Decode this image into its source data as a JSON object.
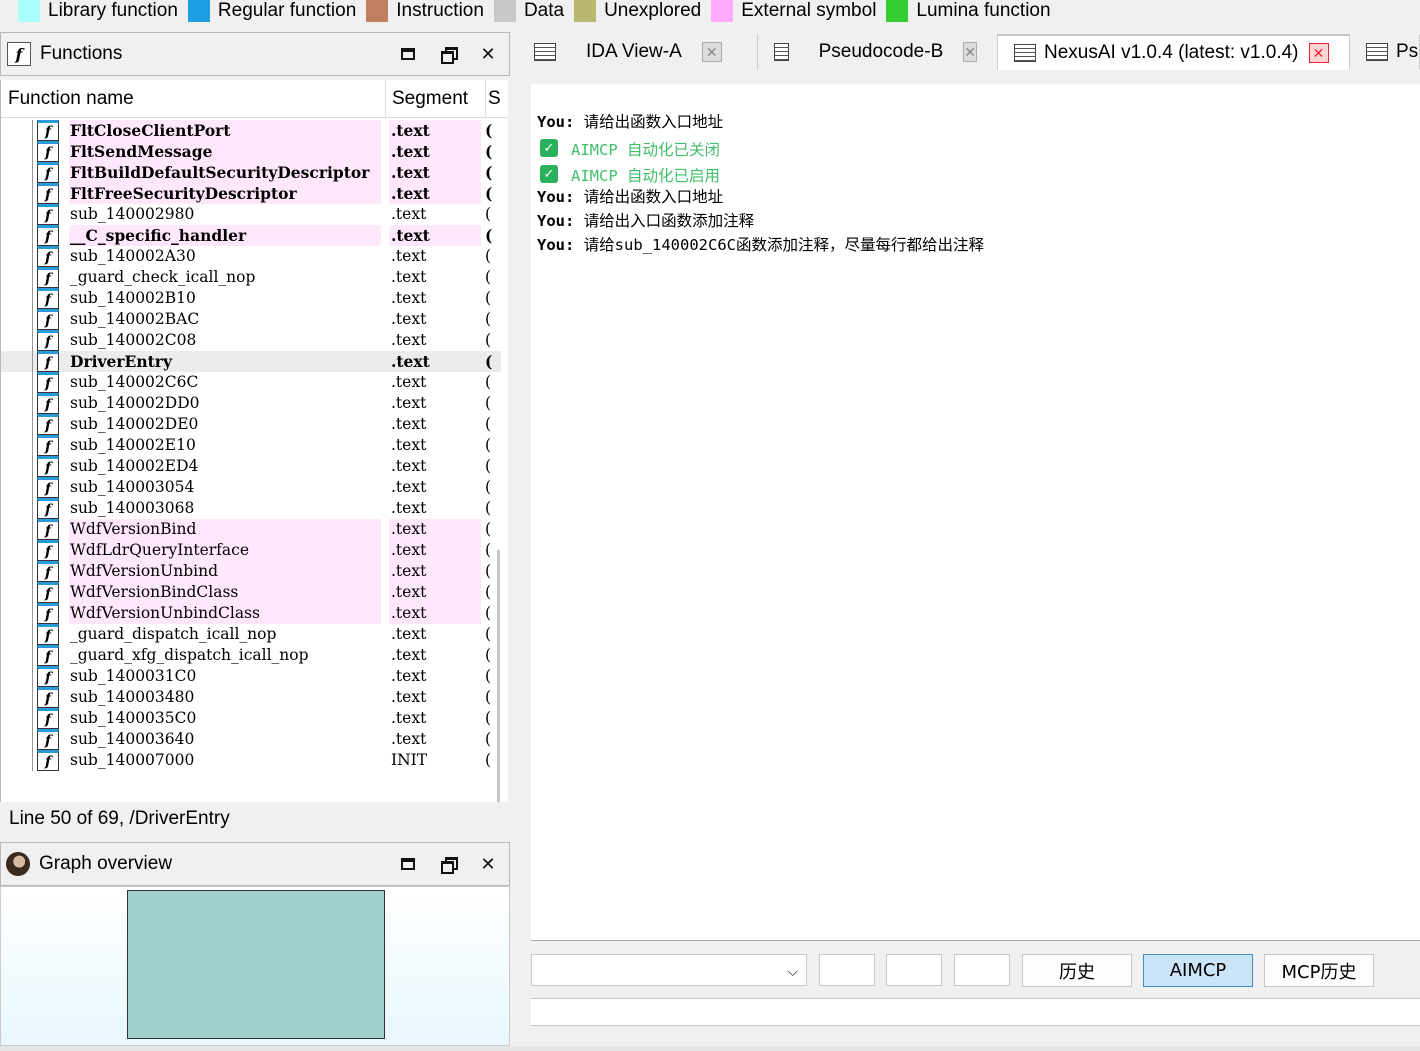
{
  "legend": [
    {
      "label": "Library function",
      "color": "#aaffff"
    },
    {
      "label": "Regular function",
      "color": "#1e9ee5"
    },
    {
      "label": "Instruction",
      "color": "#c08060"
    },
    {
      "label": "Data",
      "color": "#c8c8c8"
    },
    {
      "label": "Unexplored",
      "color": "#b8b870"
    },
    {
      "label": "External symbol",
      "color": "#ffaaff"
    },
    {
      "label": "Lumina function",
      "color": "#33cc33"
    }
  ],
  "functions_panel": {
    "title": "Functions",
    "columns": {
      "name": "Function name",
      "segment": "Segment",
      "rest": "S"
    },
    "rows": [
      {
        "name": "FltCloseClientPort",
        "segment": ".text",
        "tail": "(",
        "type": "external",
        "bold": true
      },
      {
        "name": "FltSendMessage",
        "segment": ".text",
        "tail": "(",
        "type": "external",
        "bold": true
      },
      {
        "name": "FltBuildDefaultSecurityDescriptor",
        "segment": ".text",
        "tail": "(",
        "type": "external",
        "bold": true
      },
      {
        "name": "FltFreeSecurityDescriptor",
        "segment": ".text",
        "tail": "(",
        "type": "external",
        "bold": true
      },
      {
        "name": "sub_140002980",
        "segment": ".text",
        "tail": "(",
        "type": "regular",
        "bold": false
      },
      {
        "name": "__C_specific_handler",
        "segment": ".text",
        "tail": "(",
        "type": "external",
        "bold": true
      },
      {
        "name": "sub_140002A30",
        "segment": ".text",
        "tail": "(",
        "type": "regular",
        "bold": false
      },
      {
        "name": "_guard_check_icall_nop",
        "segment": ".text",
        "tail": "(",
        "type": "regular",
        "bold": false
      },
      {
        "name": "sub_140002B10",
        "segment": ".text",
        "tail": "(",
        "type": "regular",
        "bold": false
      },
      {
        "name": "sub_140002BAC",
        "segment": ".text",
        "tail": "(",
        "type": "regular",
        "bold": false
      },
      {
        "name": "sub_140002C08",
        "segment": ".text",
        "tail": "(",
        "type": "regular",
        "bold": false
      },
      {
        "name": "DriverEntry",
        "segment": ".text",
        "tail": "(",
        "type": "selected",
        "bold": true
      },
      {
        "name": "sub_140002C6C",
        "segment": ".text",
        "tail": "(",
        "type": "regular",
        "bold": false
      },
      {
        "name": "sub_140002DD0",
        "segment": ".text",
        "tail": "(",
        "type": "regular",
        "bold": false
      },
      {
        "name": "sub_140002DE0",
        "segment": ".text",
        "tail": "(",
        "type": "regular",
        "bold": false
      },
      {
        "name": "sub_140002E10",
        "segment": ".text",
        "tail": "(",
        "type": "regular",
        "bold": false
      },
      {
        "name": "sub_140002ED4",
        "segment": ".text",
        "tail": "(",
        "type": "regular",
        "bold": false
      },
      {
        "name": "sub_140003054",
        "segment": ".text",
        "tail": "(",
        "type": "regular",
        "bold": false
      },
      {
        "name": "sub_140003068",
        "segment": ".text",
        "tail": "(",
        "type": "regular",
        "bold": false
      },
      {
        "name": "WdfVersionBind",
        "segment": ".text",
        "tail": "(",
        "type": "external",
        "bold": false
      },
      {
        "name": "WdfLdrQueryInterface",
        "segment": ".text",
        "tail": "(",
        "type": "external",
        "bold": false
      },
      {
        "name": "WdfVersionUnbind",
        "segment": ".text",
        "tail": "(",
        "type": "external",
        "bold": false
      },
      {
        "name": "WdfVersionBindClass",
        "segment": ".text",
        "tail": "(",
        "type": "external",
        "bold": false
      },
      {
        "name": "WdfVersionUnbindClass",
        "segment": ".text",
        "tail": "(",
        "type": "external",
        "bold": false
      },
      {
        "name": "_guard_dispatch_icall_nop",
        "segment": ".text",
        "tail": "(",
        "type": "regular",
        "bold": false
      },
      {
        "name": "_guard_xfg_dispatch_icall_nop",
        "segment": ".text",
        "tail": "(",
        "type": "regular",
        "bold": false
      },
      {
        "name": "sub_1400031C0",
        "segment": ".text",
        "tail": "(",
        "type": "regular",
        "bold": false
      },
      {
        "name": "sub_140003480",
        "segment": ".text",
        "tail": "(",
        "type": "regular",
        "bold": false
      },
      {
        "name": "sub_1400035C0",
        "segment": ".text",
        "tail": "(",
        "type": "regular",
        "bold": false
      },
      {
        "name": "sub_140003640",
        "segment": ".text",
        "tail": "(",
        "type": "regular",
        "bold": false
      },
      {
        "name": "sub_140007000",
        "segment": "INIT",
        "tail": "(",
        "type": "regular",
        "bold": false
      }
    ],
    "status": "Line 50 of 69, /DriverEntry"
  },
  "graph_panel": {
    "title": "Graph overview"
  },
  "tabs": [
    {
      "label": "IDA View-A",
      "active": false
    },
    {
      "label": "Pseudocode-B",
      "active": false
    },
    {
      "label": "NexusAI v1.0.4 (latest: v1.0.4)",
      "active": true
    },
    {
      "label": "Ps",
      "active": false
    }
  ],
  "chat": [
    {
      "kind": "user",
      "who": "You:",
      "text": "请给出函数入口地址"
    },
    {
      "kind": "status",
      "text": "AIMCP 自动化已关闭"
    },
    {
      "kind": "status",
      "text": "AIMCP 自动化已启用"
    },
    {
      "kind": "user",
      "who": "You:",
      "text": "请给出函数入口地址"
    },
    {
      "kind": "user",
      "who": "You:",
      "text": "请给出入口函数添加注释"
    },
    {
      "kind": "user",
      "who": "You:",
      "text": "请给sub_140002C6C函数添加注释，尽量每行都给出注释"
    }
  ],
  "controls": {
    "history": "历史",
    "aimcp": "AIMCP",
    "mcp_history": "MCP历史"
  }
}
